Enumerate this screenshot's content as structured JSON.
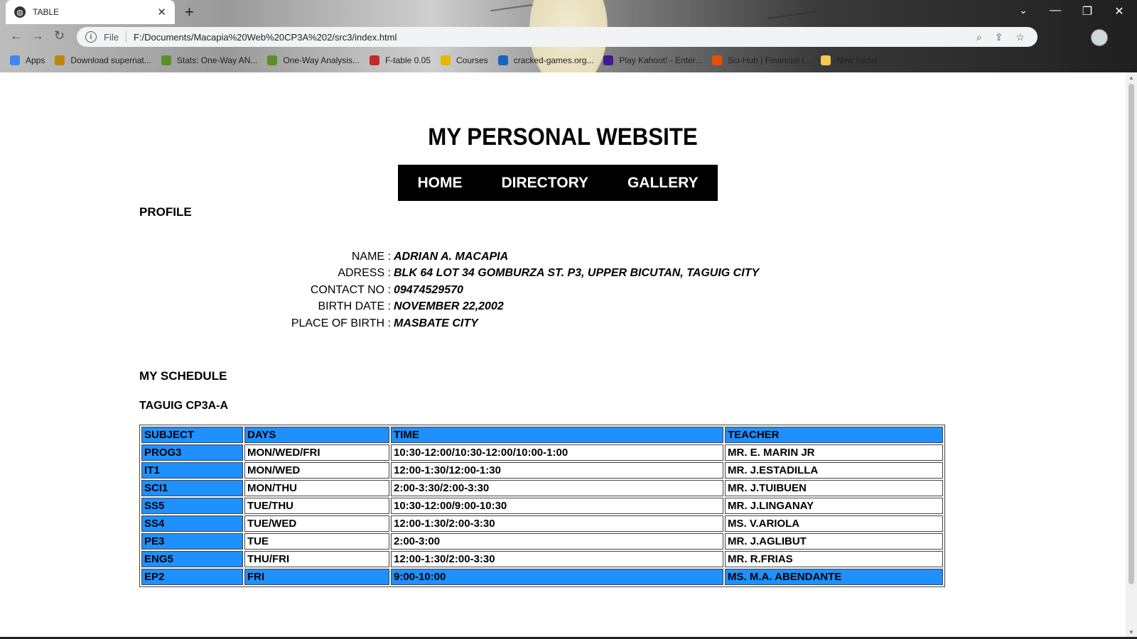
{
  "browser": {
    "tab_title": "TABLE",
    "tab_close": "✕",
    "new_tab": "+",
    "file_label": "File",
    "url": "F:/Documents/Macapia%20Web%20CP3A%202/src3/index.html",
    "bookmarks": [
      {
        "label": "Apps",
        "color": "#4285f4"
      },
      {
        "label": "Download supernat...",
        "color": "#b8860b"
      },
      {
        "label": "Stats: One-Way AN...",
        "color": "#5a8f29"
      },
      {
        "label": "One-Way Analysis...",
        "color": "#5a8f29"
      },
      {
        "label": "F-table 0.05",
        "color": "#c62828"
      },
      {
        "label": "Courses",
        "color": "#e6b800"
      },
      {
        "label": "cracked-games.org...",
        "color": "#1565c0"
      },
      {
        "label": "Play Kahoot! - Enter...",
        "color": "#46178f"
      },
      {
        "label": "Sci-Hub | Financial f...",
        "color": "#e65100"
      },
      {
        "label": "New folder",
        "color": "#f9c74f"
      }
    ]
  },
  "site": {
    "title": "MY PERSONAL WEBSITE",
    "nav": [
      "HOME",
      "DIRECTORY",
      "GALLERY"
    ]
  },
  "profile": {
    "heading": "PROFILE",
    "rows": [
      {
        "label": "NAME :",
        "value": "ADRIAN A. MACAPIA"
      },
      {
        "label": "ADRESS :",
        "value": "BLK 64 LOT 34 GOMBURZA ST. P3, UPPER BICUTAN, TAGUIG CITY"
      },
      {
        "label": "CONTACT NO :",
        "value": "09474529570"
      },
      {
        "label": "BIRTH DATE :",
        "value": "NOVEMBER 22,2002"
      },
      {
        "label": "PLACE OF BIRTH :",
        "value": "MASBATE CITY"
      }
    ]
  },
  "schedule": {
    "heading": "MY SCHEDULE",
    "section": "TAGUIG CP3A-A",
    "accent_color": "#1e90ff",
    "columns": [
      "SUBJECT",
      "DAYS",
      "TIME",
      "TEACHER"
    ],
    "rows": [
      [
        "PROG3",
        "MON/WED/FRI",
        "10:30-12:00/10:30-12:00/10:00-1:00",
        "MR. E. MARIN JR"
      ],
      [
        "IT1",
        "MON/WED",
        "12:00-1:30/12:00-1:30",
        "MR. J.ESTADILLA"
      ],
      [
        "SCI1",
        "MON/THU",
        "2:00-3:30/2:00-3:30",
        "MR. J.TUIBUEN"
      ],
      [
        "SS5",
        "TUE/THU",
        "10:30-12:00/9:00-10:30",
        "MR. J.LINGANAY"
      ],
      [
        "SS4",
        "TUE/WED",
        "12:00-1:30/2:00-3:30",
        "MS. V.ARIOLA"
      ],
      [
        "PE3",
        "TUE",
        "2:00-3:00",
        "MR. J.AGLIBUT"
      ],
      [
        "ENG5",
        "THU/FRI",
        "12:00-1:30/2:00-3:30",
        "MR. R.FRIAS"
      ],
      [
        "EP2",
        "FRI",
        "9:00-10:00",
        "MS. M.A. ABENDANTE"
      ]
    ]
  }
}
